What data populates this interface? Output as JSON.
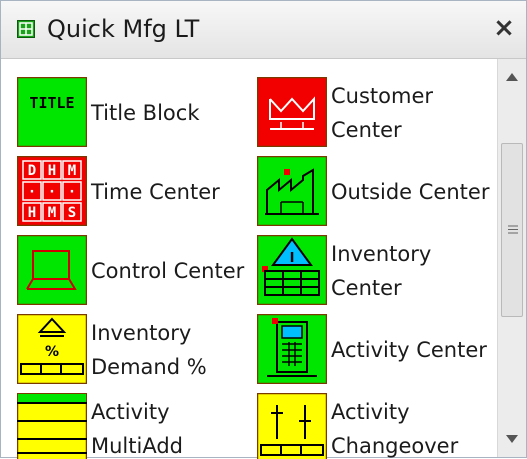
{
  "window": {
    "title": "Quick Mfg LT",
    "close_label": "×",
    "title_icon": "grid-icon"
  },
  "items": [
    {
      "label": "Title Block",
      "icon": "title-block-icon",
      "icon_text": "TITLE",
      "bg": "#00e600"
    },
    {
      "label": "Customer Center",
      "icon": "customer-center-icon",
      "bg": "#f20000"
    },
    {
      "label": "Time Center",
      "icon": "time-center-icon",
      "icon_text": [
        "D",
        "H",
        "M",
        "·",
        "·",
        "·",
        "H",
        "M",
        "S"
      ],
      "bg": "#f20000"
    },
    {
      "label": "Outside Center",
      "icon": "outside-center-icon",
      "bg": "#00e600"
    },
    {
      "label": "Control Center",
      "icon": "control-center-icon",
      "bg": "#00e600"
    },
    {
      "label": "Inventory Center",
      "icon": "inventory-center-icon",
      "icon_text": "I",
      "bg": "#00e600"
    },
    {
      "label": "Inventory Demand %",
      "icon": "inventory-demand-icon",
      "icon_text": "%",
      "bg": "#ffff00"
    },
    {
      "label": "Activity Center",
      "icon": "activity-center-icon",
      "bg": "#00e600"
    },
    {
      "label": "Activity MultiAdd",
      "icon": "activity-multiadd-icon",
      "bg": "#ffff00"
    },
    {
      "label": "Activity Changeover",
      "icon": "activity-changeover-icon",
      "bg": "#ffff00"
    }
  ],
  "scrollbar": {
    "up": "▲",
    "down": "▼",
    "grip": "≡"
  }
}
